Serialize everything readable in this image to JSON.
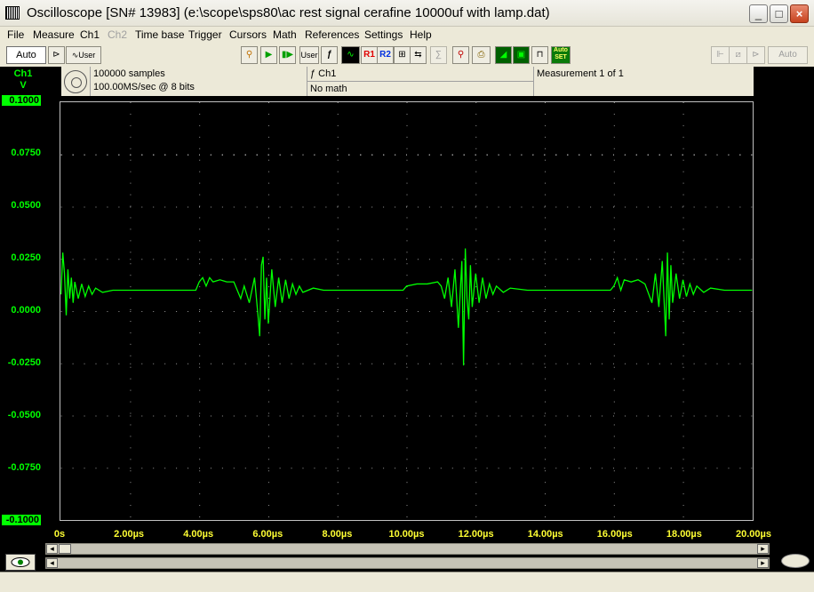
{
  "window": {
    "title": "Oscilloscope  [SN# 13983]  (e:\\scope\\sps80\\ac rest signal cerafine 10000uf with lamp.dat)",
    "minimize": "_",
    "maximize": "□",
    "close": "×"
  },
  "menu": [
    "File",
    "Measure",
    "Ch1",
    "Ch2",
    "Time base",
    "Trigger",
    "Cursors",
    "Math",
    "References",
    "Settings",
    "Help"
  ],
  "toolbar": {
    "auto_label": "Auto",
    "user_label": "User",
    "user2_label": "User",
    "r1_label": "R1",
    "r2_label": "R2",
    "autoset_label": "Auto SET",
    "right_auto_label": "Auto"
  },
  "info": {
    "samples": "100000 samples",
    "rate": "100.00MS/sec @ 8 bits",
    "channel": "ƒ Ch1",
    "math": "No math",
    "measurement": "Measurement 1 of 1"
  },
  "channel": {
    "name": "Ch1",
    "unit": "V",
    "color": "#00ff00"
  },
  "chart_data": {
    "type": "line",
    "xlabel": "",
    "ylabel": "",
    "x_ticks": [
      "0s",
      "2.00µs",
      "4.00µs",
      "6.00µs",
      "8.00µs",
      "10.00µs",
      "12.00µs",
      "14.00µs",
      "16.00µs",
      "18.00µs",
      "20.00µs"
    ],
    "y_ticks": [
      "0.1000",
      "0.0750",
      "0.0500",
      "0.0250",
      "0.0000",
      "-0.0250",
      "-0.0500",
      "-0.0750",
      "-0.1000"
    ],
    "xlim": [
      0,
      20
    ],
    "ylim": [
      -0.1,
      0.1
    ],
    "grid": true,
    "series": [
      {
        "color": "#00ff00",
        "points": [
          [
            0.0,
            0.008
          ],
          [
            0.05,
            0.028
          ],
          [
            0.1,
            0.018
          ],
          [
            0.15,
            -0.002
          ],
          [
            0.2,
            0.02
          ],
          [
            0.25,
            0.006
          ],
          [
            0.3,
            0.016
          ],
          [
            0.35,
            0.004
          ],
          [
            0.4,
            0.014
          ],
          [
            0.5,
            0.006
          ],
          [
            0.6,
            0.013
          ],
          [
            0.7,
            0.007
          ],
          [
            0.8,
            0.012
          ],
          [
            0.9,
            0.008
          ],
          [
            1.0,
            0.011
          ],
          [
            1.2,
            0.009
          ],
          [
            1.5,
            0.01
          ],
          [
            2.0,
            0.01
          ],
          [
            3.0,
            0.01
          ],
          [
            3.9,
            0.01
          ],
          [
            4.0,
            0.014
          ],
          [
            4.1,
            0.016
          ],
          [
            4.2,
            0.012
          ],
          [
            4.3,
            0.016
          ],
          [
            4.4,
            0.014
          ],
          [
            4.6,
            0.015
          ],
          [
            4.8,
            0.014
          ],
          [
            5.0,
            0.014
          ],
          [
            5.2,
            0.006
          ],
          [
            5.3,
            0.012
          ],
          [
            5.45,
            0.004
          ],
          [
            5.6,
            0.016
          ],
          [
            5.7,
            -0.002
          ],
          [
            5.75,
            -0.012
          ],
          [
            5.8,
            0.022
          ],
          [
            5.85,
            0.026
          ],
          [
            5.9,
            -0.004
          ],
          [
            5.95,
            0.016
          ],
          [
            6.0,
            -0.006
          ],
          [
            6.1,
            0.02
          ],
          [
            6.2,
            0.002
          ],
          [
            6.3,
            0.016
          ],
          [
            6.4,
            0.004
          ],
          [
            6.5,
            0.015
          ],
          [
            6.6,
            0.006
          ],
          [
            6.7,
            0.013
          ],
          [
            6.8,
            0.008
          ],
          [
            6.9,
            0.012
          ],
          [
            7.0,
            0.009
          ],
          [
            7.3,
            0.011
          ],
          [
            7.6,
            0.01
          ],
          [
            8.0,
            0.01
          ],
          [
            9.0,
            0.01
          ],
          [
            9.9,
            0.01
          ],
          [
            10.0,
            0.012
          ],
          [
            10.3,
            0.013
          ],
          [
            10.6,
            0.013
          ],
          [
            10.9,
            0.014
          ],
          [
            11.0,
            0.012
          ],
          [
            11.1,
            0.006
          ],
          [
            11.2,
            0.016
          ],
          [
            11.3,
            0.002
          ],
          [
            11.4,
            0.02
          ],
          [
            11.5,
            -0.008
          ],
          [
            11.6,
            0.024
          ],
          [
            11.65,
            -0.026
          ],
          [
            11.7,
            0.03
          ],
          [
            11.75,
            0.006
          ],
          [
            11.8,
            -0.004
          ],
          [
            11.85,
            0.022
          ],
          [
            11.9,
            0.002
          ],
          [
            12.0,
            0.018
          ],
          [
            12.1,
            0.004
          ],
          [
            12.2,
            0.016
          ],
          [
            12.3,
            0.006
          ],
          [
            12.4,
            0.013
          ],
          [
            12.5,
            0.008
          ],
          [
            12.6,
            0.012
          ],
          [
            12.8,
            0.009
          ],
          [
            13.0,
            0.011
          ],
          [
            13.5,
            0.01
          ],
          [
            14.0,
            0.01
          ],
          [
            15.0,
            0.01
          ],
          [
            15.9,
            0.01
          ],
          [
            16.0,
            0.012
          ],
          [
            16.1,
            0.016
          ],
          [
            16.2,
            0.01
          ],
          [
            16.3,
            0.015
          ],
          [
            16.5,
            0.014
          ],
          [
            16.7,
            0.015
          ],
          [
            16.9,
            0.013
          ],
          [
            17.1,
            0.004
          ],
          [
            17.2,
            0.018
          ],
          [
            17.3,
            0.002
          ],
          [
            17.4,
            0.024
          ],
          [
            17.5,
            -0.012
          ],
          [
            17.55,
            0.028
          ],
          [
            17.6,
            -0.004
          ],
          [
            17.65,
            0.022
          ],
          [
            17.7,
            0.004
          ],
          [
            17.8,
            0.018
          ],
          [
            17.9,
            0.006
          ],
          [
            18.0,
            0.015
          ],
          [
            18.1,
            0.007
          ],
          [
            18.2,
            0.013
          ],
          [
            18.3,
            0.008
          ],
          [
            18.4,
            0.012
          ],
          [
            18.6,
            0.009
          ],
          [
            18.8,
            0.011
          ],
          [
            19.2,
            0.01
          ],
          [
            20.0,
            0.01
          ]
        ]
      }
    ]
  }
}
